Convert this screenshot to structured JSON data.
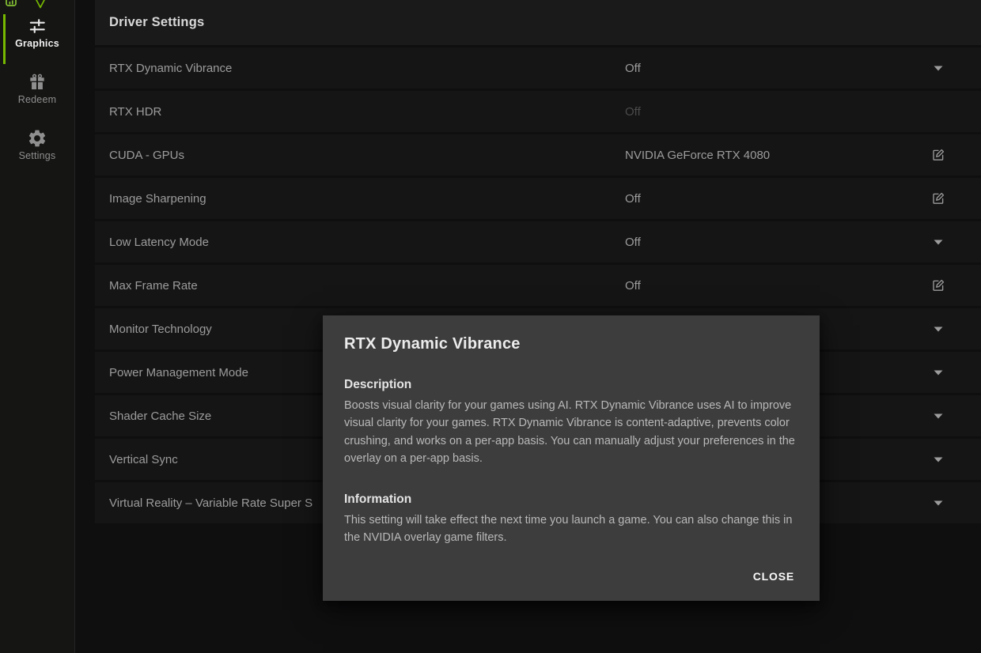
{
  "colors": {
    "accent_green": "#76b900",
    "modal_background": "#3d3d3d",
    "disabled_value": "#4b4b4b"
  },
  "sidebar": {
    "items": [
      {
        "label": "Graphics",
        "icon": "sliders-icon",
        "active": true
      },
      {
        "label": "Redeem",
        "icon": "gift-icon",
        "active": false
      },
      {
        "label": "Settings",
        "icon": "gear-icon",
        "active": false
      }
    ]
  },
  "header": {
    "title": "Driver Settings"
  },
  "settings": {
    "rows": [
      {
        "label": "RTX Dynamic Vibrance",
        "value": "Off",
        "control": "chevron",
        "disabled": false
      },
      {
        "label": "RTX HDR",
        "value": "Off",
        "control": "none",
        "disabled": true
      },
      {
        "label": "CUDA - GPUs",
        "value": "NVIDIA GeForce RTX 4080",
        "control": "edit",
        "disabled": false
      },
      {
        "label": "Image Sharpening",
        "value": "Off",
        "control": "edit",
        "disabled": false
      },
      {
        "label": "Low Latency Mode",
        "value": "Off",
        "control": "chevron",
        "disabled": false
      },
      {
        "label": "Max Frame Rate",
        "value": "Off",
        "control": "edit",
        "disabled": false
      },
      {
        "label": "Monitor Technology",
        "value": "",
        "control": "chevron",
        "disabled": false
      },
      {
        "label": "Power Management Mode",
        "value": "",
        "control": "chevron",
        "disabled": false
      },
      {
        "label": "Shader Cache Size",
        "value": "",
        "control": "chevron",
        "disabled": false
      },
      {
        "label": "Vertical Sync",
        "value": "",
        "control": "chevron",
        "disabled": false
      },
      {
        "label": "Virtual Reality – Variable Rate Super S",
        "value": "",
        "control": "chevron",
        "disabled": false
      }
    ]
  },
  "modal": {
    "title": "RTX Dynamic Vibrance",
    "description_heading": "Description",
    "description_body": "Boosts visual clarity for your games using AI. RTX Dynamic Vibrance uses AI to improve visual clarity for your games. RTX Dynamic Vibrance is content-adaptive, prevents color crushing, and works on a per-app basis. You can manually adjust your preferences in the overlay on a per-app basis.",
    "information_heading": "Information",
    "information_body": "This setting will take effect the next time you launch a game. You can also change this in the NVIDIA overlay game filters.",
    "close_label": "CLOSE"
  }
}
